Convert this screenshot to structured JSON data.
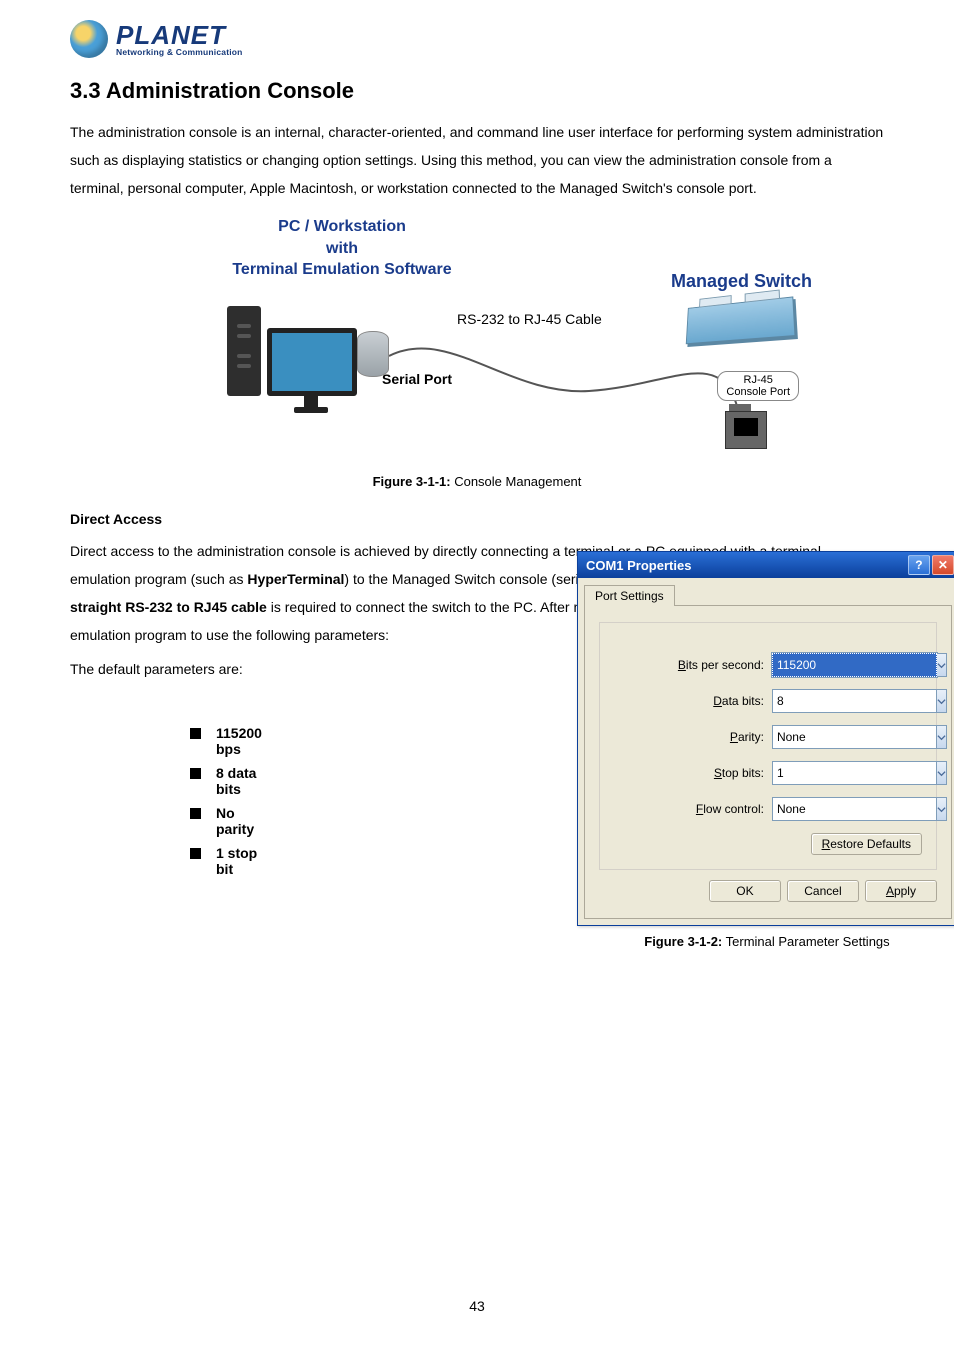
{
  "logo": {
    "name": "PLANET",
    "tagline": "Networking & Communication"
  },
  "heading": "3.3 Administration Console",
  "intro": "The administration console is an internal, character-oriented, and command line user interface for performing system administration such as displaying statistics or changing option settings. Using this method, you can view the administration console from a terminal, personal computer, Apple Macintosh, or workstation connected to the Managed Switch's console port.",
  "diagram": {
    "pc_label_l1": "PC / Workstation",
    "pc_label_l2": "with",
    "pc_label_l3": "Terminal Emulation Software",
    "switch_label": "Managed Switch",
    "cable_label": "RS-232 to RJ-45 Cable",
    "serial_label": "Serial Port",
    "port_label_l1": "RJ-45",
    "port_label_l2": "Console Port"
  },
  "fig1": {
    "num": "Figure 3-1-1:",
    "cap": " Console Management"
  },
  "sub_heading": "Direct Access",
  "para2_a": "Direct access to the administration console is achieved by directly connecting a terminal or a PC equipped with a terminal-emulation program (such as ",
  "para2_b": "HyperTerminal",
  "para2_c": ") to the Managed Switch console (serial) port. When using this management method, a ",
  "para2_d": "straight RS-232 to RJ45 cable",
  "para2_e": " is required to connect the switch to the PC. After making this connection, configure the terminal-emulation program to use the following parameters:",
  "para3": "The default parameters are:",
  "params": [
    "115200 bps",
    "8 data bits",
    "No parity",
    "1 stop bit"
  ],
  "dialog": {
    "title": "COM1 Properties",
    "tab": "Port Settings",
    "fields": {
      "bps": {
        "pre": "B",
        "rest": "its per second:",
        "value": "115200"
      },
      "databits": {
        "pre": "D",
        "rest": "ata bits:",
        "value": "8"
      },
      "parity": {
        "pre": "P",
        "rest": "arity:",
        "value": "None"
      },
      "stopbits": {
        "pre": "S",
        "rest": "top bits:",
        "value": "1"
      },
      "flow": {
        "pre": "F",
        "rest": "low control:",
        "value": "None"
      }
    },
    "restore": {
      "pre": "R",
      "rest": "estore Defaults"
    },
    "ok": "OK",
    "cancel": "Cancel",
    "apply": {
      "pre": "A",
      "rest": "pply"
    }
  },
  "fig2": {
    "num": "Figure 3-1-2:",
    "cap": " Terminal Parameter Settings"
  },
  "page_number": "43"
}
